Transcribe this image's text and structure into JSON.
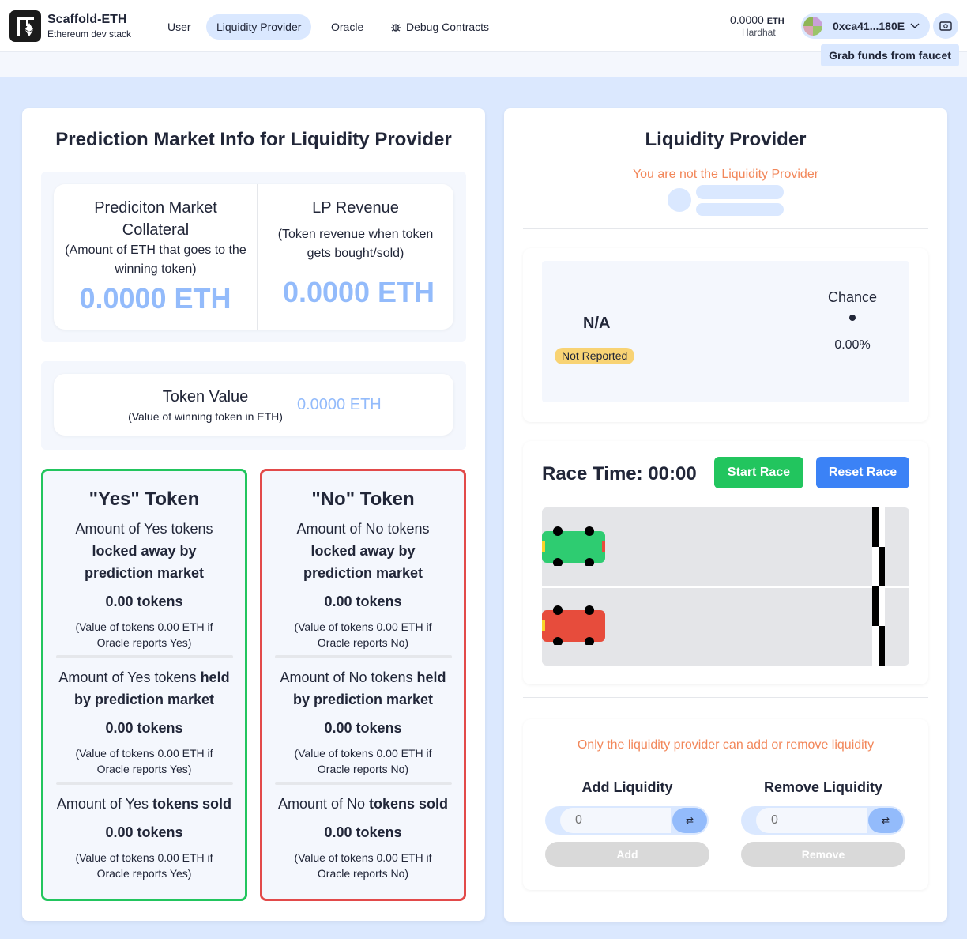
{
  "header": {
    "brand_title": "Scaffold-ETH",
    "brand_subtitle": "Ethereum dev stack",
    "nav": [
      {
        "label": "User"
      },
      {
        "label": "Liquidity Provider",
        "active": true
      },
      {
        "label": "Oracle"
      },
      {
        "label": "Debug Contracts",
        "icon": "bug-icon"
      }
    ],
    "balance_value": "0.0000",
    "balance_unit": "ETH",
    "network": "Hardhat",
    "account_address": "0xca41...180E",
    "faucet_tooltip": "Grab funds from faucet"
  },
  "info": {
    "title": "Prediction Market Info for Liquidity Provider",
    "collateral_title": "Prediciton Market Collateral",
    "collateral_desc": "(Amount of ETH that goes to the winning token)",
    "collateral_value": "0.0000 ETH",
    "revenue_title": "LP Revenue",
    "revenue_desc": "(Token revenue when token gets bought/sold)",
    "revenue_value": "0.0000 ETH",
    "token_value_title": "Token Value",
    "token_value_desc": "(Value of winning token in ETH)",
    "token_value_amount": "0.0000 ETH"
  },
  "yes_token": {
    "title": "\"Yes\" Token",
    "locked_label_pre": "Amount of Yes tokens",
    "locked_label_bold": "locked away by prediction market",
    "locked_amount": "0.00 tokens",
    "locked_value": "(Value of tokens 0.00 ETH if Oracle reports Yes)",
    "held_label_pre": "Amount of Yes tokens",
    "held_label_bold1": "held",
    "held_label_bold2": "by prediction market",
    "held_amount": "0.00 tokens",
    "held_value": "(Value of tokens 0.00 ETH if Oracle reports Yes)",
    "sold_label_pre": "Amount of Yes",
    "sold_label_bold": "tokens sold",
    "sold_amount": "0.00 tokens",
    "sold_value": "(Value of tokens 0.00 ETH if Oracle reports Yes)"
  },
  "no_token": {
    "title": "\"No\" Token",
    "locked_label_pre": "Amount of No tokens",
    "locked_label_bold": "locked away by prediction market",
    "locked_amount": "0.00 tokens",
    "locked_value": "(Value of tokens 0.00 ETH if Oracle reports No)",
    "held_label_pre": "Amount of No tokens",
    "held_label_bold1": "held",
    "held_label_bold2": "by prediction market",
    "held_amount": "0.00 tokens",
    "held_value": "(Value of tokens 0.00 ETH if Oracle reports No)",
    "sold_label_pre": "Amount of No",
    "sold_label_bold": "tokens sold",
    "sold_amount": "0.00 tokens",
    "sold_value": "(Value of tokens 0.00 ETH if Oracle reports No)"
  },
  "lp": {
    "title": "Liquidity Provider",
    "not_lp_notice": "You are not the Liquidity Provider",
    "outcome": "N/A",
    "status_badge": "Not Reported",
    "chance_label": "Chance",
    "chance_value": "0.00%",
    "race_time_label": "Race Time:",
    "race_time_value": "00:00",
    "start_race": "Start Race",
    "reset_race": "Reset Race",
    "liquidity_notice": "Only the liquidity provider can add or remove liquidity",
    "add_title": "Add Liquidity",
    "remove_title": "Remove Liquidity",
    "add_placeholder": "0",
    "remove_placeholder": "0",
    "add_button": "Add",
    "remove_button": "Remove",
    "colors": {
      "accent_orange": "#f2875a",
      "start_green": "#22c55e",
      "reset_blue": "#3b82f6",
      "car_green": "#2ecc71",
      "car_red": "#e74c3c"
    }
  }
}
